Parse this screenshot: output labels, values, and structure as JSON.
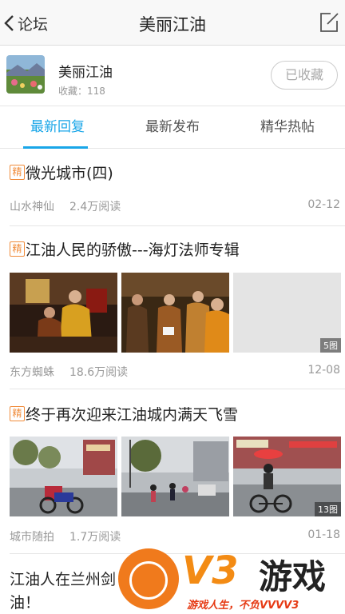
{
  "nav": {
    "back_label": "论坛",
    "title": "美丽江油"
  },
  "forum": {
    "name": "美丽江油",
    "fav_count": "收藏：118",
    "fav_button": "已收藏"
  },
  "tabs": [
    "最新回复",
    "最新发布",
    "精华热帖"
  ],
  "posts": [
    {
      "badge": "精",
      "title": "微光城市(四)",
      "author": "山水神仙",
      "reads": "2.4万阅读",
      "date": "02-12"
    },
    {
      "badge": "精",
      "title": "江油人民的骄傲---海灯法师专辑",
      "author": "东方蜘蛛",
      "reads": "18.6万阅读",
      "date": "12-08",
      "image_count": "5图"
    },
    {
      "badge": "精",
      "title": "终于再次迎来江油城内满天飞雪",
      "author": "城市随拍",
      "reads": "1.7万阅读",
      "date": "01-18",
      "image_count": "13图"
    },
    {
      "title_line1": "江油人在兰州剑",
      "title_line2": "油！"
    }
  ],
  "watermark": {
    "brand": "V3",
    "word": "游戏",
    "slogan": "游戏人生，不负VVVV3"
  },
  "colors": {
    "accent": "#19a6e8",
    "badge": "#f08c3b"
  }
}
